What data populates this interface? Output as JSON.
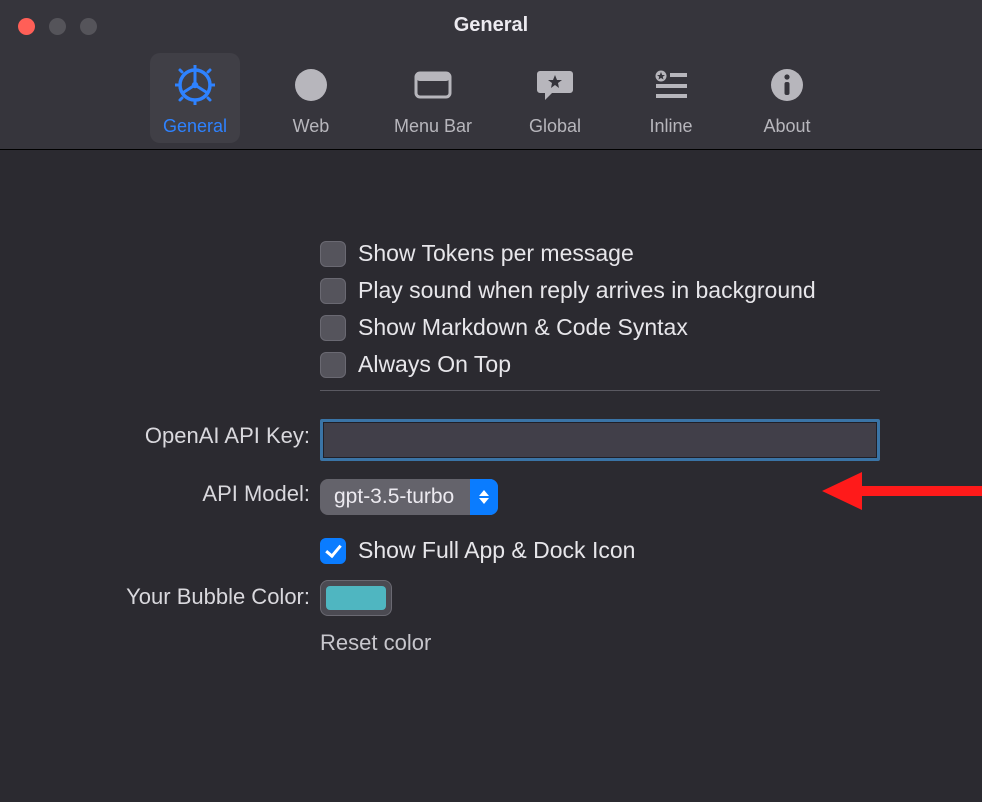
{
  "window": {
    "title": "General"
  },
  "tabs": {
    "general": "General",
    "web": "Web",
    "menubar": "Menu Bar",
    "global": "Global",
    "inline": "Inline",
    "about": "About"
  },
  "checkboxes": {
    "show_tokens": "Show Tokens per message",
    "play_sound": "Play sound when reply arrives in background",
    "show_markdown": "Show Markdown & Code Syntax",
    "always_on_top": "Always On Top",
    "show_full_app": "Show Full App & Dock Icon"
  },
  "labels": {
    "api_key": "OpenAI API Key:",
    "api_model": "API Model:",
    "bubble_color": "Your Bubble Color:",
    "reset_color": "Reset color"
  },
  "values": {
    "api_key": "",
    "api_model": "gpt-3.5-turbo",
    "bubble_color": "#4fb6c1"
  }
}
